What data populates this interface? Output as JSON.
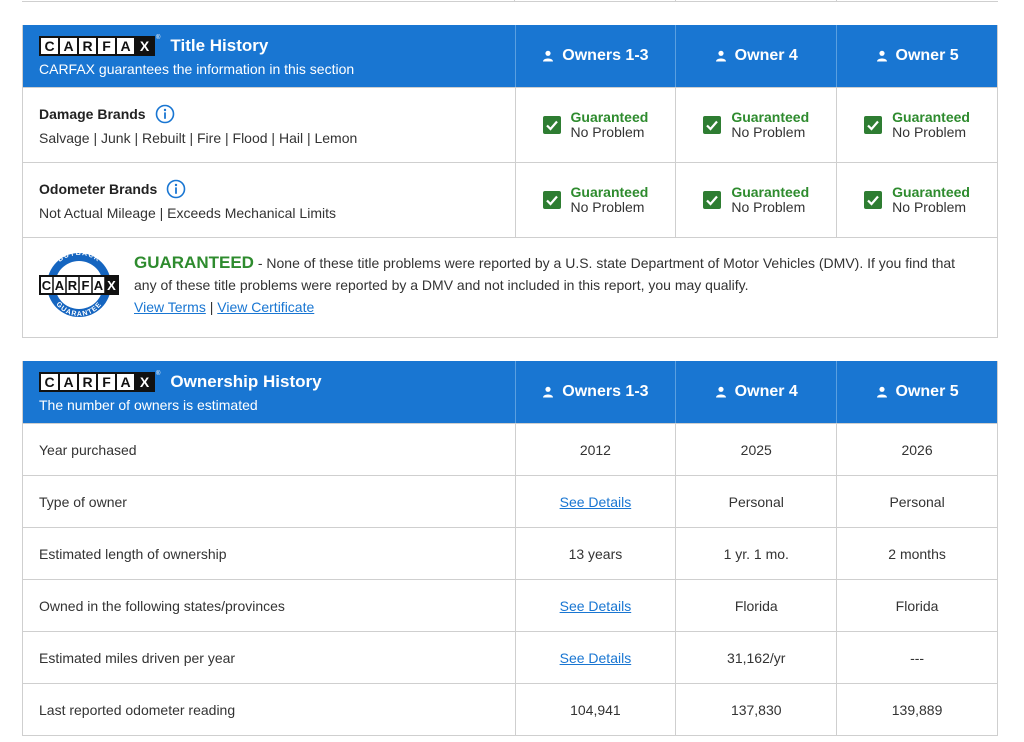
{
  "logo_letters": [
    "C",
    "A",
    "R",
    "F",
    "A",
    "X"
  ],
  "title_section": {
    "title": "Title History",
    "subtitle": "CARFAX guarantees the information in this section",
    "owner_columns": [
      "Owners 1-3",
      "Owner 4",
      "Owner 5"
    ],
    "rows": [
      {
        "title": "Damage Brands",
        "subtitle": "Salvage | Junk | Rebuilt | Fire | Flood | Hail | Lemon",
        "values": [
          {
            "top": "Guaranteed",
            "bottom": "No Problem"
          },
          {
            "top": "Guaranteed",
            "bottom": "No Problem"
          },
          {
            "top": "Guaranteed",
            "bottom": "No Problem"
          }
        ]
      },
      {
        "title": "Odometer Brands",
        "subtitle": "Not Actual Mileage | Exceeds Mechanical Limits",
        "values": [
          {
            "top": "Guaranteed",
            "bottom": "No Problem"
          },
          {
            "top": "Guaranteed",
            "bottom": "No Problem"
          },
          {
            "top": "Guaranteed",
            "bottom": "No Problem"
          }
        ]
      }
    ],
    "guarantee": {
      "headline": "GUARANTEED",
      "text": " - None of these title problems were reported by a U.S. state Department of Motor Vehicles (DMV). If you find that any of these title problems were reported by a DMV and not included in this report, you may qualify.",
      "link_terms": "View Terms",
      "link_separator": " | ",
      "link_certificate": "View Certificate",
      "seal_top": "BUYBACK",
      "seal_bottom": "GUARANTEE"
    }
  },
  "ownership_section": {
    "title": "Ownership History",
    "subtitle": "The number of owners is estimated",
    "owner_columns": [
      "Owners 1-3",
      "Owner 4",
      "Owner 5"
    ],
    "rows": [
      {
        "label": "Year purchased",
        "values": [
          "2012",
          "2025",
          "2026"
        ]
      },
      {
        "label": "Type of owner",
        "values": [
          "See Details",
          "Personal",
          "Personal"
        ]
      },
      {
        "label": "Estimated length of ownership",
        "values": [
          "13 years",
          "1 yr. 1 mo.",
          "2 months"
        ]
      },
      {
        "label": "Owned in the following states/provinces",
        "values": [
          "See Details",
          "Florida",
          "Florida"
        ]
      },
      {
        "label": "Estimated miles driven per year",
        "values": [
          "See Details",
          "31,162/yr",
          "---"
        ]
      },
      {
        "label": "Last reported odometer reading",
        "values": [
          "104,941",
          "137,830",
          "139,889"
        ]
      }
    ]
  },
  "colors": {
    "header_blue": "#1976d2",
    "guaranteed_green": "#2e8b2e",
    "link_blue": "#1976d2"
  }
}
